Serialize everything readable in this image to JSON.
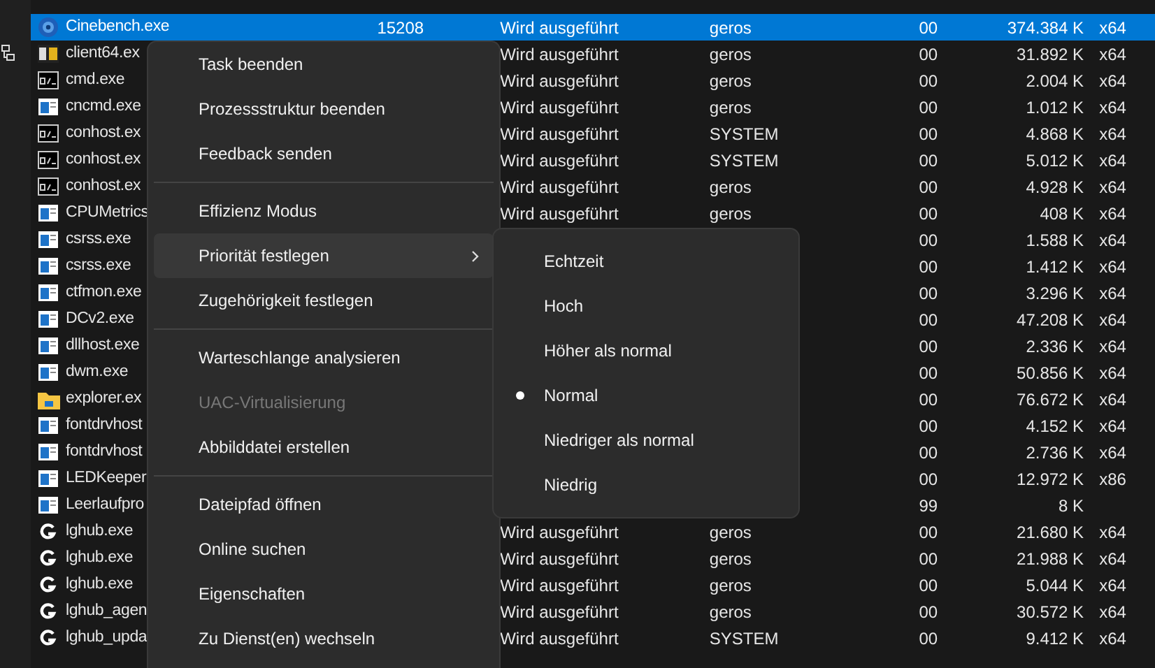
{
  "rows": [
    {
      "kind": "disc",
      "name": "Cinebench.exe",
      "pid": "15208",
      "status": "Wird ausgeführt",
      "user": "geros",
      "priority": "00",
      "memory": "374.384 K",
      "arch": "x64",
      "selected": true
    },
    {
      "kind": "letters",
      "name": "client64.ex",
      "status": "Wird ausgeführt",
      "user": "geros",
      "priority": "00",
      "memory": "31.892 K",
      "arch": "x64",
      "selected": false
    },
    {
      "kind": "console",
      "name": "cmd.exe",
      "status": "Wird ausgeführt",
      "user": "geros",
      "priority": "00",
      "memory": "2.004 K",
      "arch": "x64",
      "selected": false
    },
    {
      "kind": "app",
      "name": "cncmd.exe",
      "status": "Wird ausgeführt",
      "user": "geros",
      "priority": "00",
      "memory": "1.012 K",
      "arch": "x64",
      "selected": false
    },
    {
      "kind": "console",
      "name": "conhost.ex",
      "status": "Wird ausgeführt",
      "user": "SYSTEM",
      "priority": "00",
      "memory": "4.868 K",
      "arch": "x64",
      "selected": false
    },
    {
      "kind": "console",
      "name": "conhost.ex",
      "status": "Wird ausgeführt",
      "user": "SYSTEM",
      "priority": "00",
      "memory": "5.012 K",
      "arch": "x64",
      "selected": false
    },
    {
      "kind": "console",
      "name": "conhost.ex",
      "status": "Wird ausgeführt",
      "user": "geros",
      "priority": "00",
      "memory": "4.928 K",
      "arch": "x64",
      "selected": false
    },
    {
      "kind": "app",
      "name": "CPUMetrics",
      "status": "Wird ausgeführt",
      "user": "geros",
      "priority": "00",
      "memory": "408 K",
      "arch": "x64",
      "selected": false
    },
    {
      "kind": "app",
      "name": "csrss.exe",
      "priority": "00",
      "memory": "1.588 K",
      "arch": "x64",
      "selected": false
    },
    {
      "kind": "app",
      "name": "csrss.exe",
      "priority": "00",
      "memory": "1.412 K",
      "arch": "x64",
      "selected": false
    },
    {
      "kind": "app",
      "name": "ctfmon.exe",
      "priority": "00",
      "memory": "3.296 K",
      "arch": "x64",
      "selected": false
    },
    {
      "kind": "app",
      "name": "DCv2.exe",
      "priority": "00",
      "memory": "47.208 K",
      "arch": "x64",
      "selected": false
    },
    {
      "kind": "app",
      "name": "dllhost.exe",
      "priority": "00",
      "memory": "2.336 K",
      "arch": "x64",
      "selected": false
    },
    {
      "kind": "app",
      "name": "dwm.exe",
      "priority": "00",
      "memory": "50.856 K",
      "arch": "x64",
      "selected": false
    },
    {
      "kind": "folder",
      "name": "explorer.ex",
      "priority": "00",
      "memory": "76.672 K",
      "arch": "x64",
      "selected": false
    },
    {
      "kind": "app",
      "name": "fontdrvhost",
      "priority": "00",
      "memory": "4.152 K",
      "arch": "x64",
      "selected": false
    },
    {
      "kind": "app",
      "name": "fontdrvhost",
      "priority": "00",
      "memory": "2.736 K",
      "arch": "x64",
      "selected": false
    },
    {
      "kind": "app",
      "name": "LEDKeeper",
      "priority": "00",
      "memory": "12.972 K",
      "arch": "x86",
      "selected": false
    },
    {
      "kind": "app",
      "name": "Leerlaufpro",
      "priority": "99",
      "memory": "8 K",
      "selected": false
    },
    {
      "kind": "logo",
      "name": "lghub.exe",
      "status": "Wird ausgeführt",
      "user": "geros",
      "priority": "00",
      "memory": "21.680 K",
      "arch": "x64",
      "selected": false
    },
    {
      "kind": "logo",
      "name": "lghub.exe",
      "status": "Wird ausgeführt",
      "user": "geros",
      "priority": "00",
      "memory": "21.988 K",
      "arch": "x64",
      "selected": false
    },
    {
      "kind": "logo",
      "name": "lghub.exe",
      "status": "Wird ausgeführt",
      "user": "geros",
      "priority": "00",
      "memory": "5.044 K",
      "arch": "x64",
      "selected": false
    },
    {
      "kind": "logo",
      "name": "lghub_agen",
      "status": "Wird ausgeführt",
      "user": "geros",
      "priority": "00",
      "memory": "30.572 K",
      "arch": "x64",
      "selected": false
    },
    {
      "kind": "logo",
      "name": "lghub_upda",
      "status": "Wird ausgeführt",
      "user": "SYSTEM",
      "priority": "00",
      "memory": "9.412 K",
      "arch": "x64",
      "selected": false
    }
  ],
  "context_menu": {
    "groups": [
      [
        {
          "label": "Task beenden",
          "disabled": false,
          "selected": false,
          "submenu": false
        },
        {
          "label": "Prozessstruktur beenden",
          "disabled": false,
          "selected": false,
          "submenu": false
        },
        {
          "label": "Feedback senden",
          "disabled": false,
          "selected": false,
          "submenu": false
        }
      ],
      [
        {
          "label": "Effizienz Modus",
          "disabled": false,
          "selected": false,
          "submenu": false
        },
        {
          "label": "Priorität festlegen",
          "disabled": false,
          "selected": true,
          "submenu": true
        },
        {
          "label": "Zugehörigkeit festlegen",
          "disabled": false,
          "selected": false,
          "submenu": false
        }
      ],
      [
        {
          "label": "Warteschlange analysieren",
          "disabled": false,
          "selected": false,
          "submenu": false
        },
        {
          "label": "UAC-Virtualisierung",
          "disabled": true,
          "selected": false,
          "submenu": false
        },
        {
          "label": "Abbilddatei erstellen",
          "disabled": false,
          "selected": false,
          "submenu": false
        }
      ],
      [
        {
          "label": "Dateipfad öffnen",
          "disabled": false,
          "selected": false,
          "submenu": false
        },
        {
          "label": "Online suchen",
          "disabled": false,
          "selected": false,
          "submenu": false
        },
        {
          "label": "Eigenschaften",
          "disabled": false,
          "selected": false,
          "submenu": false
        },
        {
          "label": "Zu Dienst(en) wechseln",
          "disabled": false,
          "selected": false,
          "submenu": false
        }
      ]
    ]
  },
  "priority_submenu": [
    {
      "label": "Echtzeit",
      "selected": false
    },
    {
      "label": "Hoch",
      "selected": false
    },
    {
      "label": "Höher als normal",
      "selected": false
    },
    {
      "label": "Normal",
      "selected": true
    },
    {
      "label": "Niedriger als normal",
      "selected": false
    },
    {
      "label": "Niedrig",
      "selected": false
    }
  ]
}
